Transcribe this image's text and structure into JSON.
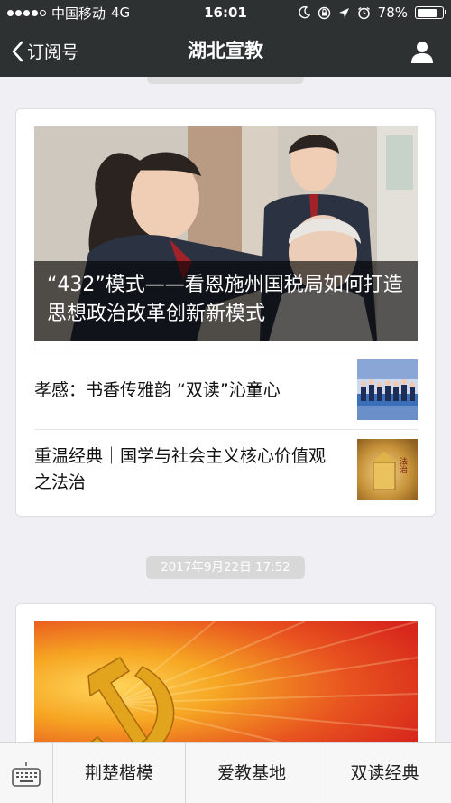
{
  "status_bar": {
    "carrier": "中国移动",
    "network": "4G",
    "time": "16:01",
    "battery": "78%",
    "battery_level": 0.78
  },
  "nav": {
    "back_label": "订阅号",
    "title": "湖北宣教"
  },
  "feed": {
    "card1": {
      "hero_title": "“432”模式——看恩施州国税局如何打造思想政治改革创新新模式",
      "articles": [
        {
          "title": "孝感：书香传雅韵 “双读”沁童心"
        },
        {
          "title": "重温经典｜国学与社会主义核心价值观之法治",
          "thumb_text": "法治"
        }
      ]
    },
    "date_badge": "2017年9月22日 17:52"
  },
  "bottom_menu": {
    "items": [
      "荆楚楷模",
      "爱教基地",
      "双读经典"
    ]
  },
  "colors": {
    "bar_bg": "#2e3132",
    "page_bg": "#efeff4",
    "banner_red": "#d7261c",
    "banner_gold": "#f6a623"
  },
  "icons": [
    "back-chevron-icon",
    "profile-icon",
    "keyboard-icon",
    "moon-icon",
    "location-arrow-icon",
    "alarm-icon",
    "rotation-lock-icon"
  ]
}
